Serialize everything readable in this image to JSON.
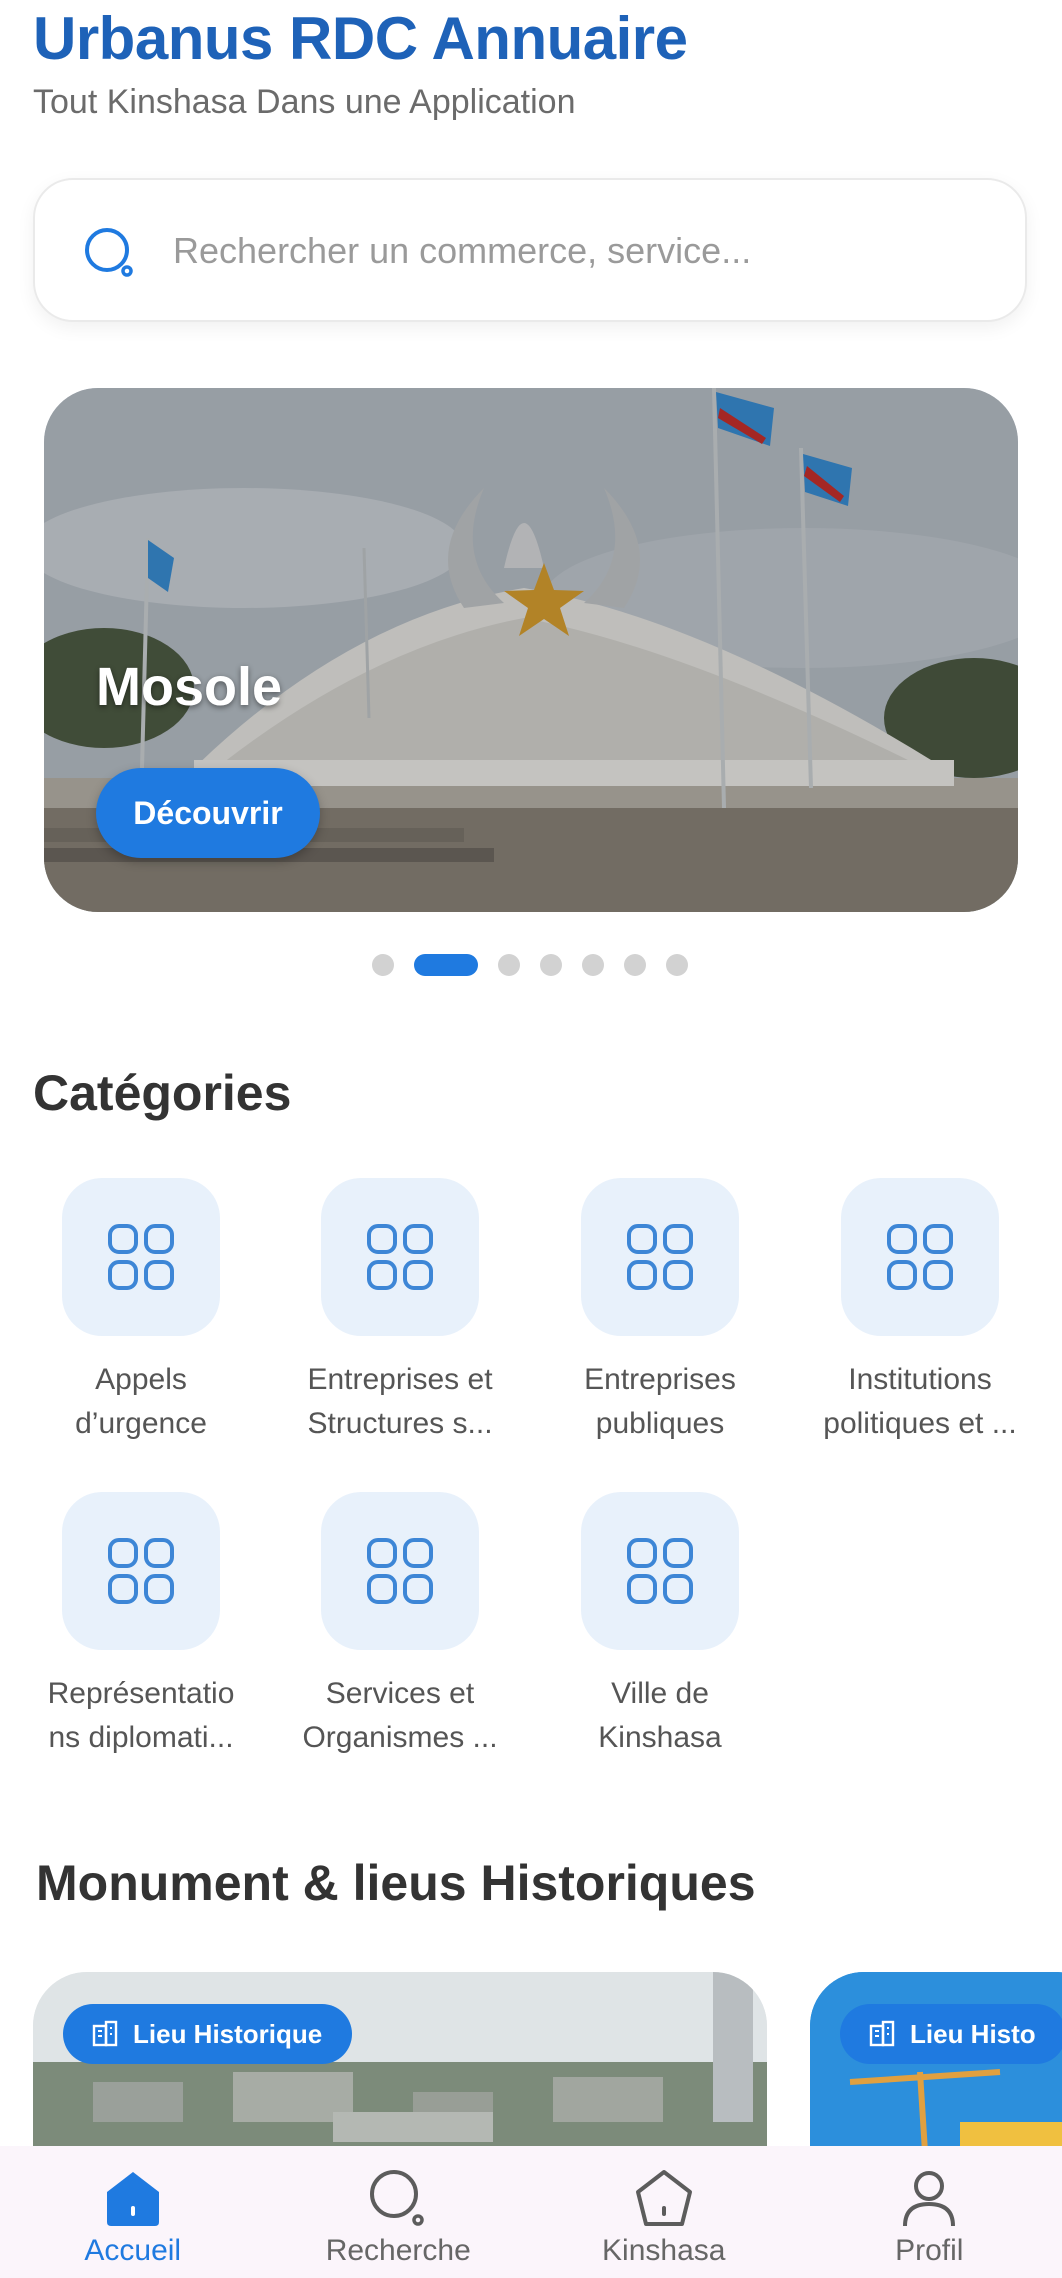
{
  "header": {
    "title": "Urbanus RDC Annuaire",
    "subtitle": "Tout Kinshasa Dans une Application"
  },
  "search": {
    "placeholder": "Rechercher un commerce, service...",
    "icon": "search-icon"
  },
  "carousel": {
    "slide_title": "Mosole",
    "button_label": "Découvrir",
    "dot_count": 7,
    "active_index": 1
  },
  "categories": {
    "title": "Catégories",
    "items": [
      {
        "label": "Appels\nd’urgence",
        "icon": "grid-icon"
      },
      {
        "label": "Entreprises et\nStructures s...",
        "icon": "grid-icon"
      },
      {
        "label": "Entreprises\npubliques",
        "icon": "grid-icon"
      },
      {
        "label": "Institutions\npolitiques et ...",
        "icon": "grid-icon"
      },
      {
        "label": "Représentatio\nns diplomati...",
        "icon": "grid-icon"
      },
      {
        "label": "Services et\nOrganismes ...",
        "icon": "grid-icon"
      },
      {
        "label": "Ville de\nKinshasa",
        "icon": "grid-icon"
      }
    ]
  },
  "monuments": {
    "title": "Monument & lieus Historiques",
    "cards": [
      {
        "badge": "Lieu Historique",
        "icon": "building-icon"
      },
      {
        "badge": "Lieu Histo",
        "icon": "building-icon"
      }
    ]
  },
  "bottom_nav": {
    "items": [
      {
        "label": "Accueil",
        "icon": "home-icon",
        "active": true
      },
      {
        "label": "Recherche",
        "icon": "search-icon",
        "active": false
      },
      {
        "label": "Kinshasa",
        "icon": "pentagon-icon",
        "active": false
      },
      {
        "label": "Profil",
        "icon": "user-icon",
        "active": false
      }
    ]
  },
  "colors": {
    "accent": "#1f7ae0",
    "title_blue": "#1e62b8",
    "tile_bg": "#e8f1fb",
    "nav_bg": "#fbf5fb"
  }
}
